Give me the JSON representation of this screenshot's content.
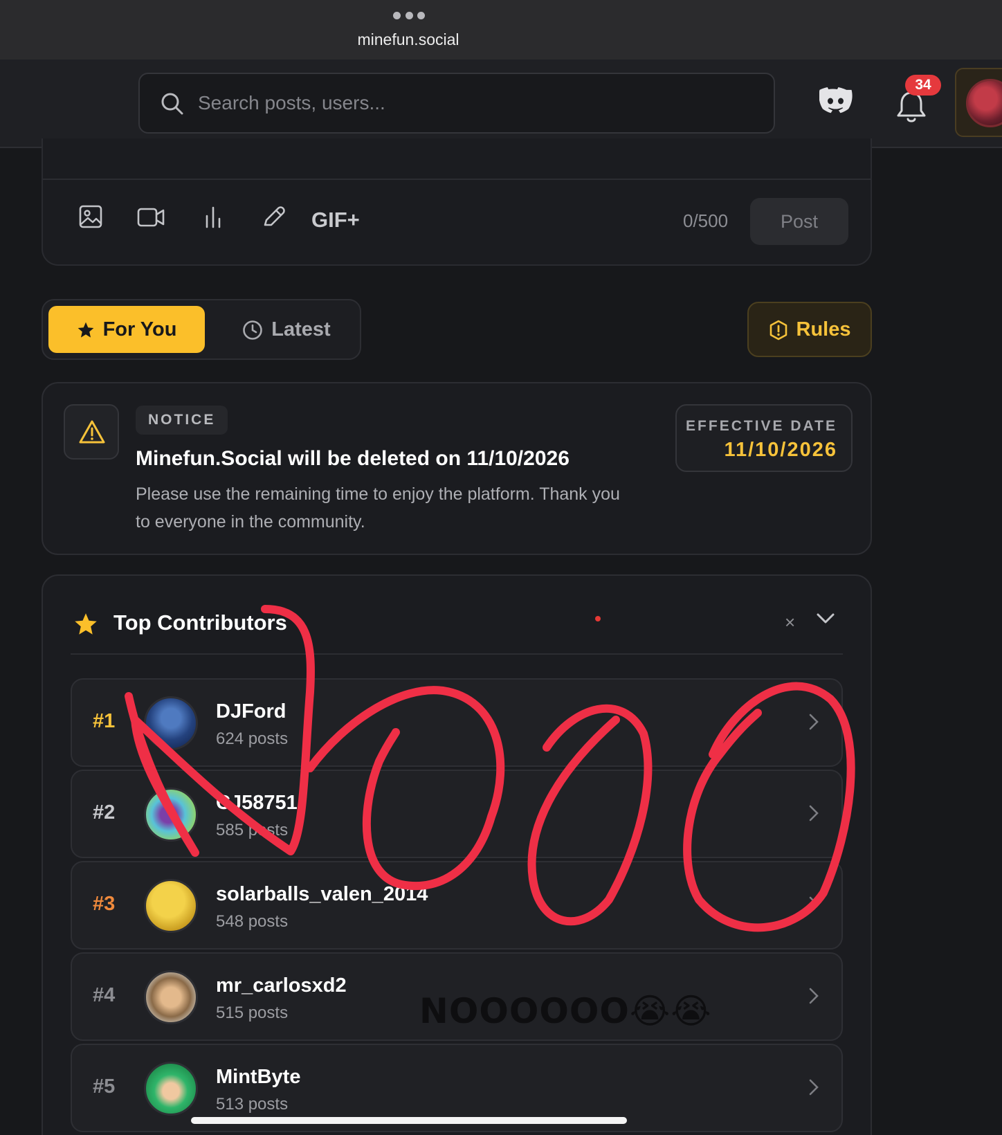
{
  "browser": {
    "url": "minefun.social"
  },
  "header": {
    "search_placeholder": "Search posts, users...",
    "notification_count": "34"
  },
  "composer": {
    "gif_label": "GIF+",
    "char_count": "0/500",
    "post_label": "Post"
  },
  "tabs": {
    "for_you": "For You",
    "latest": "Latest",
    "rules": "Rules"
  },
  "notice": {
    "tag": "NOTICE",
    "title": "Minefun.Social will be deleted on 11/10/2026",
    "body": "Please use the remaining time to enjoy the platform. Thank you to everyone in the community.",
    "effective_label": "EFFECTIVE DATE",
    "effective_date": "11/10/2026"
  },
  "contributors": {
    "title": "Top Contributors",
    "close": "×",
    "items": [
      {
        "rank": "#1",
        "name": "DJFord",
        "posts": "624 posts",
        "rank_color": "#f6c23a"
      },
      {
        "rank": "#2",
        "name": "CJ58751",
        "posts": "585 posts",
        "rank_color": "#c8c9cd"
      },
      {
        "rank": "#3",
        "name": "solarballs_valen_2014",
        "posts": "548 posts",
        "rank_color": "#f08a3c"
      },
      {
        "rank": "#4",
        "name": "mr_carlosxd2",
        "posts": "515 posts",
        "rank_color": "#8c8d92"
      },
      {
        "rank": "#5",
        "name": "MintByte",
        "posts": "513 posts",
        "rank_color": "#8c8d92"
      }
    ]
  },
  "overlay": {
    "caption": "NOOOOOO😭😭"
  },
  "colors": {
    "accent": "#fbbf2a",
    "scribble": "#ef2f46",
    "badge": "#e5393d"
  }
}
